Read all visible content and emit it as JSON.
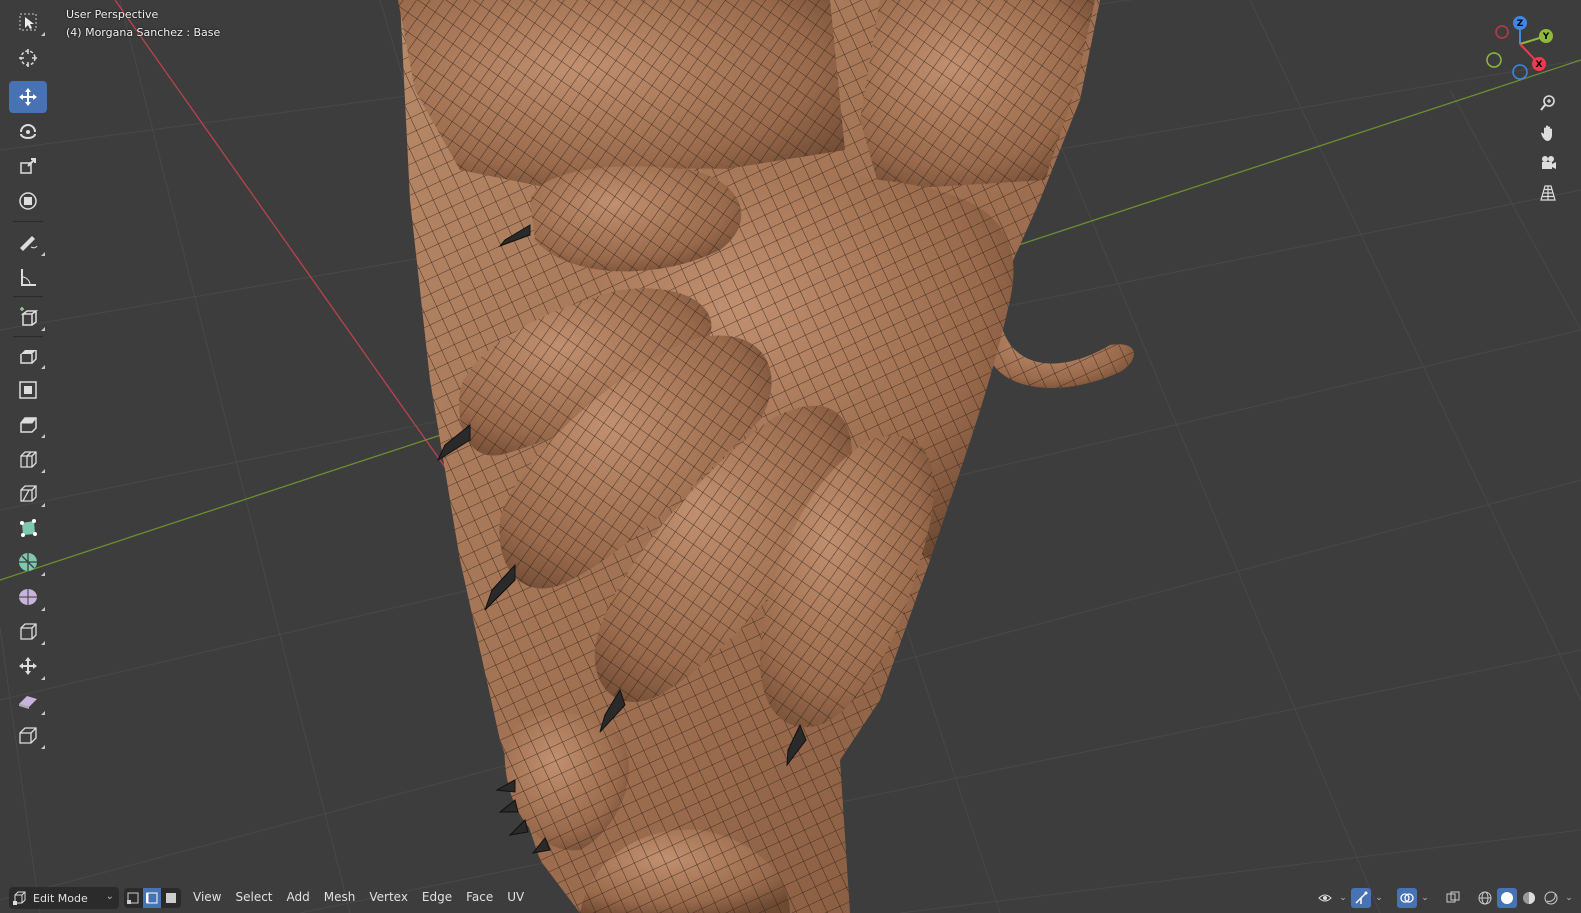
{
  "viewport": {
    "title": "User Perspective",
    "object_info": "(4) Morgana Sanchez : Base"
  },
  "gizmo": {
    "axes": [
      "Z",
      "Y",
      "X"
    ],
    "colors": {
      "x": "#ee3a4e",
      "y": "#8cba3d",
      "z": "#3f87e5"
    }
  },
  "toolbar": {
    "tools": [
      {
        "name": "select-box",
        "icon": "cursor-arrow-icon"
      },
      {
        "name": "cursor",
        "icon": "3d-cursor-icon"
      },
      {
        "name": "move",
        "icon": "move-arrows-icon",
        "active": true
      },
      {
        "name": "rotate",
        "icon": "rotate-icon"
      },
      {
        "name": "scale",
        "icon": "scale-icon"
      },
      {
        "name": "transform",
        "icon": "transform-icon"
      },
      {
        "name": "annotate",
        "icon": "pencil-icon"
      },
      {
        "name": "measure",
        "icon": "ruler-icon"
      },
      {
        "name": "add-cube",
        "icon": "add-cube-icon"
      },
      {
        "name": "extrude",
        "icon": "extrude-icon"
      },
      {
        "name": "inset",
        "icon": "inset-icon"
      },
      {
        "name": "bevel",
        "icon": "bevel-icon"
      },
      {
        "name": "loop-cut",
        "icon": "loop-cut-icon"
      },
      {
        "name": "knife",
        "icon": "knife-icon"
      },
      {
        "name": "poly-build",
        "icon": "poly-build-icon"
      },
      {
        "name": "spin",
        "icon": "spin-icon"
      },
      {
        "name": "smooth",
        "icon": "smooth-icon"
      },
      {
        "name": "edge-slide",
        "icon": "edge-slide-icon"
      },
      {
        "name": "shrink-fatten",
        "icon": "shrink-fatten-icon"
      },
      {
        "name": "shear",
        "icon": "shear-icon"
      },
      {
        "name": "rip",
        "icon": "rip-icon"
      }
    ]
  },
  "header": {
    "mode": "Edit Mode",
    "menus": [
      "View",
      "Select",
      "Add",
      "Mesh",
      "Vertex",
      "Edge",
      "Face",
      "UV"
    ]
  },
  "colors": {
    "background": "#3d3d3d",
    "grid": "#474747",
    "x_axis": "#b9434d",
    "y_axis": "#6b8f2f",
    "skin": "#a47455",
    "wire": "#1e1812",
    "accent": "#4772b3"
  }
}
